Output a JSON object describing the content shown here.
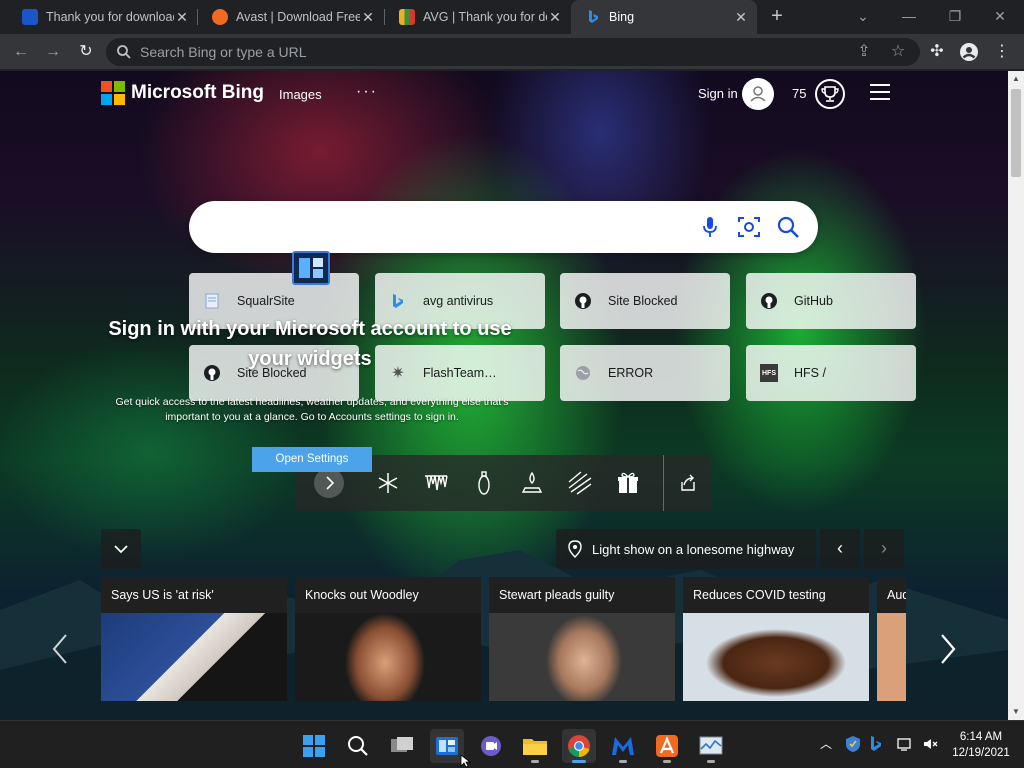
{
  "tabs": [
    {
      "title": "Thank you for download",
      "favicon": "mcafee-blue"
    },
    {
      "title": "Avast | Download Free",
      "favicon": "avast-orange"
    },
    {
      "title": "AVG | Thank you for do",
      "favicon": "avg-multicolor"
    },
    {
      "title": "Bing",
      "favicon": "bing-blue"
    }
  ],
  "address_bar": {
    "placeholder": "Search Bing or type a URL",
    "value": ""
  },
  "bing": {
    "brand": "Microsoft Bing",
    "nav_images": "Images",
    "nav_more": "···",
    "sign_in": "Sign in",
    "points": "75",
    "search_value": ""
  },
  "quick_links": [
    {
      "label": "SqualrSite",
      "icon": "doc-icon"
    },
    {
      "label": "avg antivirus",
      "icon": "bing-icon"
    },
    {
      "label": "Site Blocked",
      "icon": "github-icon"
    },
    {
      "label": "GitHub",
      "icon": "github-icon"
    },
    {
      "label": "Site Blocked",
      "icon": "github-icon"
    },
    {
      "label": "FlashTeam…",
      "icon": "gear-icon"
    },
    {
      "label": "ERROR",
      "icon": "globe-icon"
    },
    {
      "label": "HFS /",
      "icon": "hfs-icon"
    }
  ],
  "widgets_prompt": {
    "title": "Sign in with your Microsoft account to use your widgets",
    "body": "Get quick access to the latest headlines, weather updates, and everything else that's important to you at a glance. Go to Accounts settings to sign in.",
    "button": "Open Settings"
  },
  "image_caption": "Light show on a lonesome highway",
  "news_cards": [
    {
      "title": "Says US is 'at risk'"
    },
    {
      "title": "Knocks out Woodley"
    },
    {
      "title": "Stewart pleads guilty"
    },
    {
      "title": "Reduces COVID testing"
    },
    {
      "title": "Aud"
    }
  ],
  "clock": {
    "time": "6:14 AM",
    "date": "12/19/2021"
  },
  "colors": {
    "accent": "#4ca3ea",
    "ms_red": "#f25022",
    "ms_green": "#7fba00",
    "ms_blue": "#00a4ef",
    "ms_yellow": "#ffb900"
  }
}
